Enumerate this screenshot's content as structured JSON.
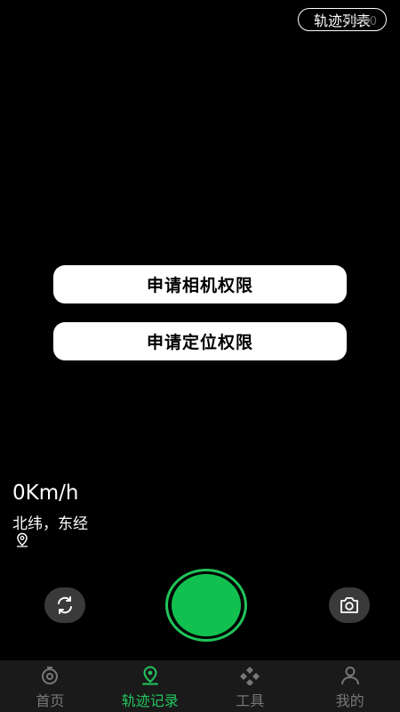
{
  "header": {
    "track_list_label": "轨迹列表",
    "track_list_overlay": "00:00"
  },
  "permissions": {
    "camera_label": "申请相机权限",
    "location_label": "申请定位权限"
  },
  "status": {
    "speed": "0Km/h",
    "coordinates": "北纬，东经"
  },
  "tabs": [
    {
      "label": "首页",
      "icon": "home-icon",
      "active": false
    },
    {
      "label": "轨迹记录",
      "icon": "location-pin-icon",
      "active": true
    },
    {
      "label": "工具",
      "icon": "tools-icon",
      "active": false
    },
    {
      "label": "我的",
      "icon": "profile-icon",
      "active": false
    }
  ],
  "colors": {
    "accent": "#22c55e",
    "record": "#12c050",
    "background": "#000000"
  }
}
